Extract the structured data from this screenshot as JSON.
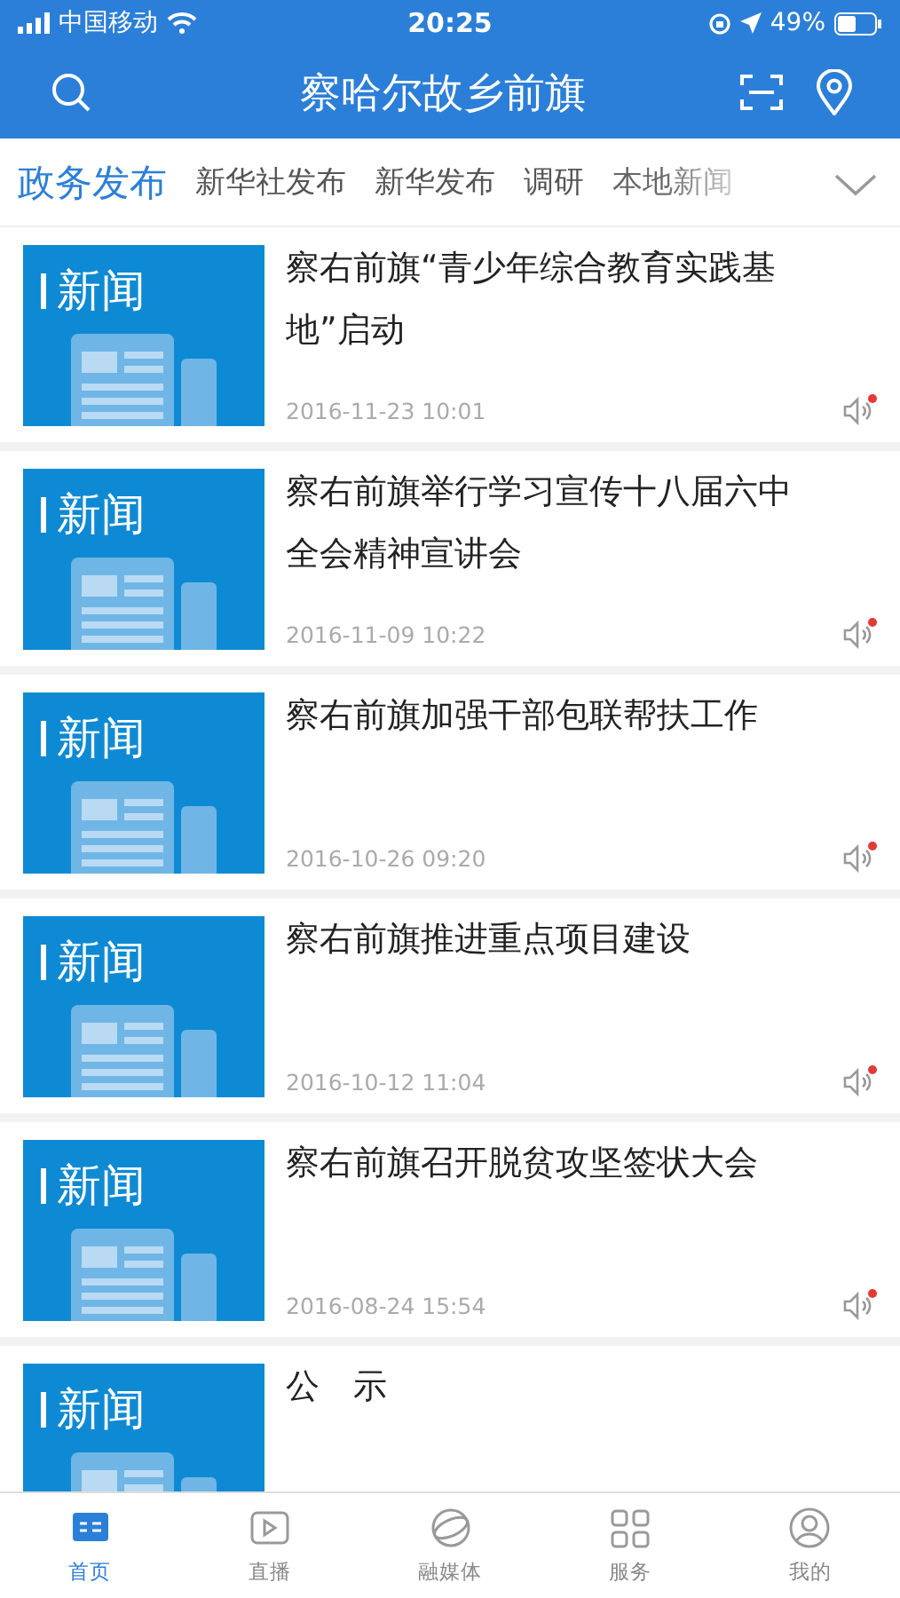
{
  "status_bar": {
    "carrier": "中国移动",
    "time": "20:25",
    "battery": "49%"
  },
  "header": {
    "title": "察哈尔故乡前旗"
  },
  "tabs": [
    {
      "label": "政务发布",
      "selected": true
    },
    {
      "label": "新华社发布",
      "selected": false
    },
    {
      "label": "新华发布",
      "selected": false
    },
    {
      "label": "调研",
      "selected": false
    },
    {
      "label": "本地新闻",
      "selected": false
    }
  ],
  "articles": [
    {
      "thumb_label": "新闻",
      "title": "察右前旗“青少年综合教育实践基地”启动",
      "date": "2016-11-23 10:01",
      "unread_audio": true
    },
    {
      "thumb_label": "新闻",
      "title": "察右前旗举行学习宣传十八届六中全会精神宣讲会",
      "date": "2016-11-09 10:22",
      "unread_audio": true
    },
    {
      "thumb_label": "新闻",
      "title": "察右前旗加强干部包联帮扶工作",
      "date": "2016-10-26 09:20",
      "unread_audio": true
    },
    {
      "thumb_label": "新闻",
      "title": "察右前旗推进重点项目建设",
      "date": "2016-10-12 11:04",
      "unread_audio": true
    },
    {
      "thumb_label": "新闻",
      "title": "察右前旗召开脱贫攻坚签状大会",
      "date": "2016-08-24 15:54",
      "unread_audio": true
    },
    {
      "thumb_label": "新闻",
      "title": "公　示"
    }
  ],
  "bottom_nav": [
    {
      "label": "首页",
      "selected": true
    },
    {
      "label": "直播",
      "selected": false
    },
    {
      "label": "融媒体",
      "selected": false
    },
    {
      "label": "服务",
      "selected": false
    },
    {
      "label": "我的",
      "selected": false
    }
  ]
}
